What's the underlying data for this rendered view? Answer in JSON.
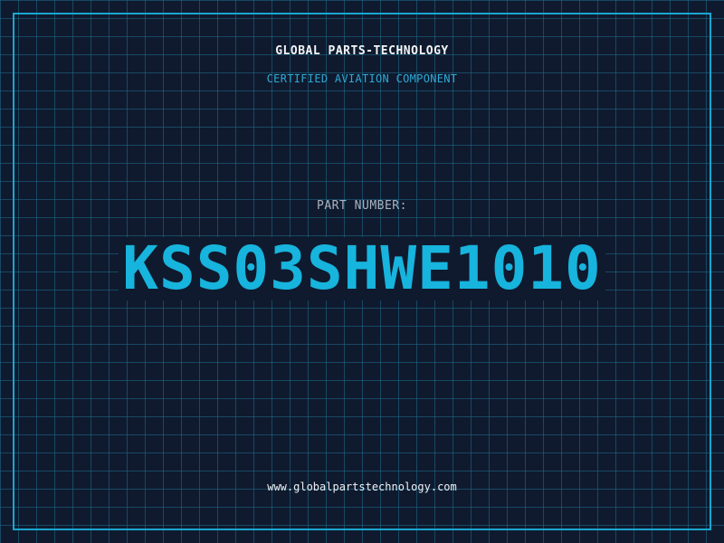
{
  "header": {
    "company": "GLOBAL PARTS-TECHNOLOGY",
    "subtitle": "CERTIFIED AVIATION COMPONENT"
  },
  "part": {
    "label": "PART NUMBER:",
    "number": "KSS03SHWE1010"
  },
  "footer": {
    "url": "www.globalpartstechnology.com"
  },
  "colors": {
    "background": "#0f1a2e",
    "grid": "#1e6e8c",
    "frame": "#1aa6cf",
    "accent": "#17b4dd",
    "subtitle": "#2fa9d6",
    "label": "#a9b3c0",
    "text": "#f2f5f8"
  }
}
